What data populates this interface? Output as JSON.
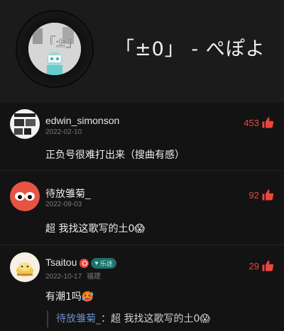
{
  "song": {
    "title": "「±0」 - ぺぽよ"
  },
  "comments": [
    {
      "user": "edwin_simonson",
      "date": "2022-02-10",
      "location": "",
      "likes": "453",
      "text": "正负号很难打出来（搜曲有感）"
    },
    {
      "user": "待放雏菊_",
      "date": "2022-09-03",
      "location": "",
      "likes": "92",
      "text": "超 我找这歌写的土0😱"
    },
    {
      "user": "Tsaitou",
      "date": "2022-10-17",
      "location": "福建",
      "likes": "29",
      "badge": "乐迷",
      "text": "有潮1吗🥵",
      "reply_user": "待放雏菊_",
      "reply_sep": "：",
      "reply_text": "超 我找这歌写的土0😱"
    }
  ],
  "colors": {
    "like": "#e9473d",
    "reply_user": "#6a8fc8"
  }
}
